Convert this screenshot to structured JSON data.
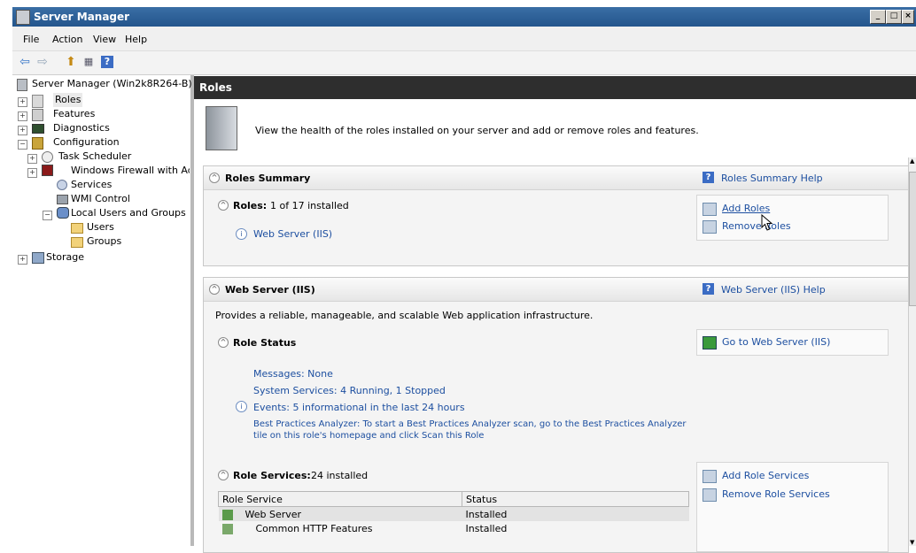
{
  "window": {
    "title": "Server Manager"
  },
  "menu": [
    "File",
    "Action",
    "View",
    "Help"
  ],
  "tree": {
    "root": "Server Manager (Win2k8R264-B)",
    "roles": "Roles",
    "features": "Features",
    "diagnostics": "Diagnostics",
    "configuration": "Configuration",
    "task_scheduler": "Task Scheduler",
    "firewall": "Windows Firewall with Adva",
    "services": "Services",
    "wmi": "WMI Control",
    "local_users": "Local Users and Groups",
    "users": "Users",
    "groups": "Groups",
    "storage": "Storage"
  },
  "page": {
    "header": "Roles",
    "intro": "View the health of the roles installed on your server and add or remove roles and features."
  },
  "roles_summary": {
    "title": "Roles Summary",
    "help": "Roles Summary Help",
    "roles_label": "Roles:",
    "roles_count": "1 of 17 installed",
    "installed_role": "Web Server (IIS)",
    "add_roles": "Add Roles",
    "remove_roles": "Remove Roles"
  },
  "web_server": {
    "title": "Web Server (IIS)",
    "help": "Web Server (IIS) Help",
    "description": "Provides a reliable, manageable, and scalable Web application infrastructure.",
    "role_status_title": "Role Status",
    "go_to": "Go to Web Server (IIS)",
    "messages": "Messages: None",
    "system_services": "System Services: 4 Running, 1 Stopped",
    "events": "Events: 5 informational in the last 24 hours",
    "bpa_line1": "Best Practices Analyzer: To start a Best Practices Analyzer scan, go to the Best Practices Analyzer",
    "bpa_line2": "tile on this role's homepage and click Scan this Role",
    "role_services_title": "Role Services:",
    "role_services_count": "24 installed",
    "add_role_services": "Add Role Services",
    "remove_role_services": "Remove Role Services",
    "table": {
      "columns": [
        "Role Service",
        "Status"
      ],
      "rows": [
        {
          "name": "Web Server",
          "status": "Installed"
        },
        {
          "name": "Common HTTP Features",
          "status": "Installed"
        }
      ]
    }
  }
}
